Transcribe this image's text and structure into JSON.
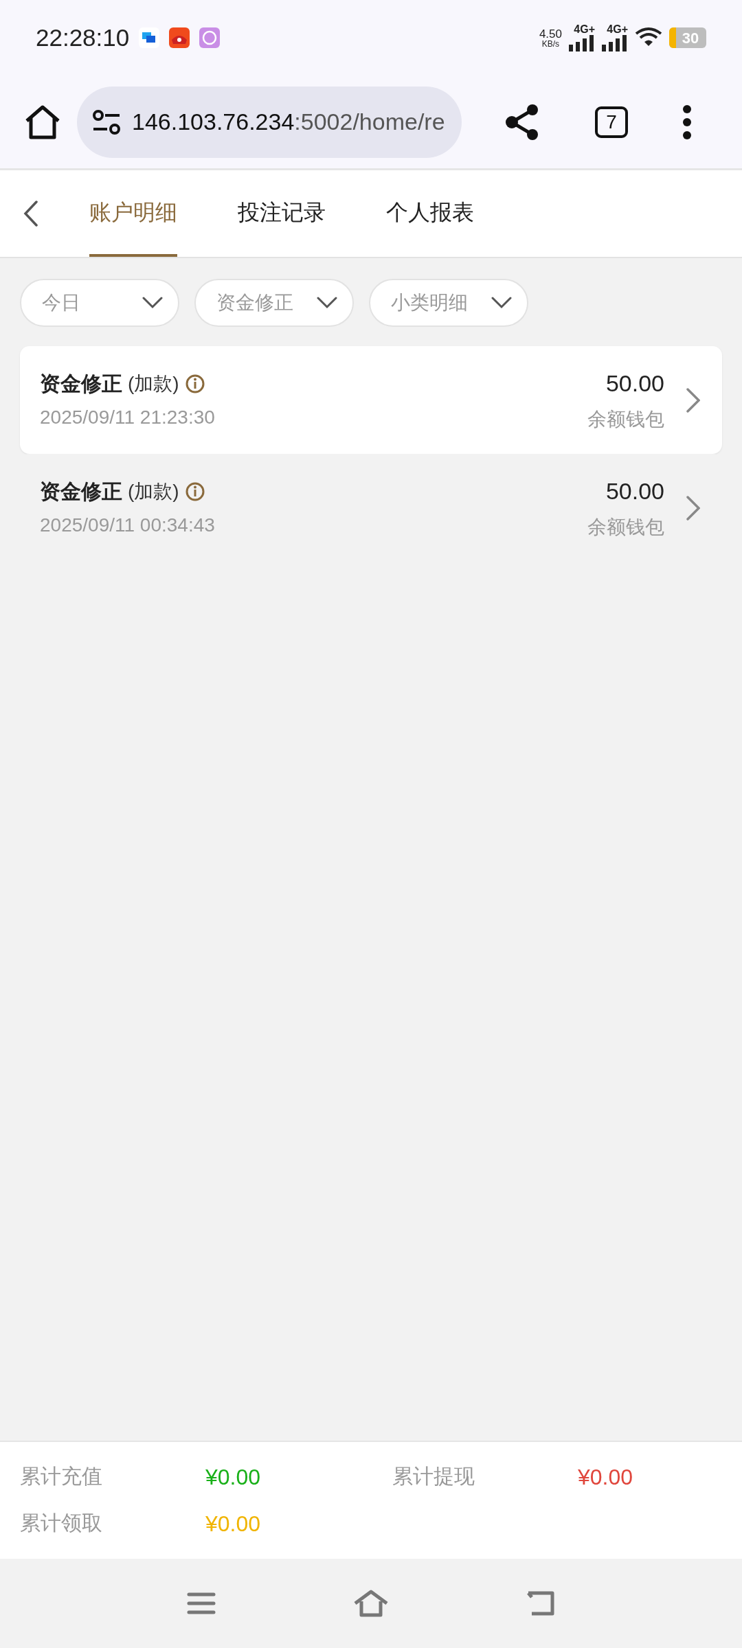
{
  "status_bar": {
    "time": "22:28:10",
    "speed": "4.50",
    "speed_unit": "KB/s",
    "networks": [
      "4G+",
      "4G+"
    ],
    "battery": "30"
  },
  "browser": {
    "url_host": "146.103.76.234",
    "url_rest": ":5002/home/re",
    "tab_count": "7"
  },
  "tabs": [
    {
      "label": "账户明细",
      "selected": true
    },
    {
      "label": "投注记录",
      "selected": false
    },
    {
      "label": "个人报表",
      "selected": false
    }
  ],
  "filters": [
    "今日",
    "资金修正",
    "小类明细"
  ],
  "records": [
    {
      "title": "资金修正",
      "note": "(加款)",
      "time": "2025/09/11 21:23:30",
      "amount": "50.00",
      "wallet": "余额钱包",
      "selected": true
    },
    {
      "title": "资金修正",
      "note": "(加款)",
      "time": "2025/09/11 00:34:43",
      "amount": "50.00",
      "wallet": "余额钱包",
      "selected": false
    }
  ],
  "summary": [
    {
      "label": "累计充值",
      "value": "¥0.00",
      "color": "#19b019"
    },
    {
      "label": "累计提现",
      "value": "¥0.00",
      "color": "#e0463c"
    },
    {
      "label": "累计领取",
      "value": "¥0.00",
      "color": "#f0b400"
    }
  ]
}
